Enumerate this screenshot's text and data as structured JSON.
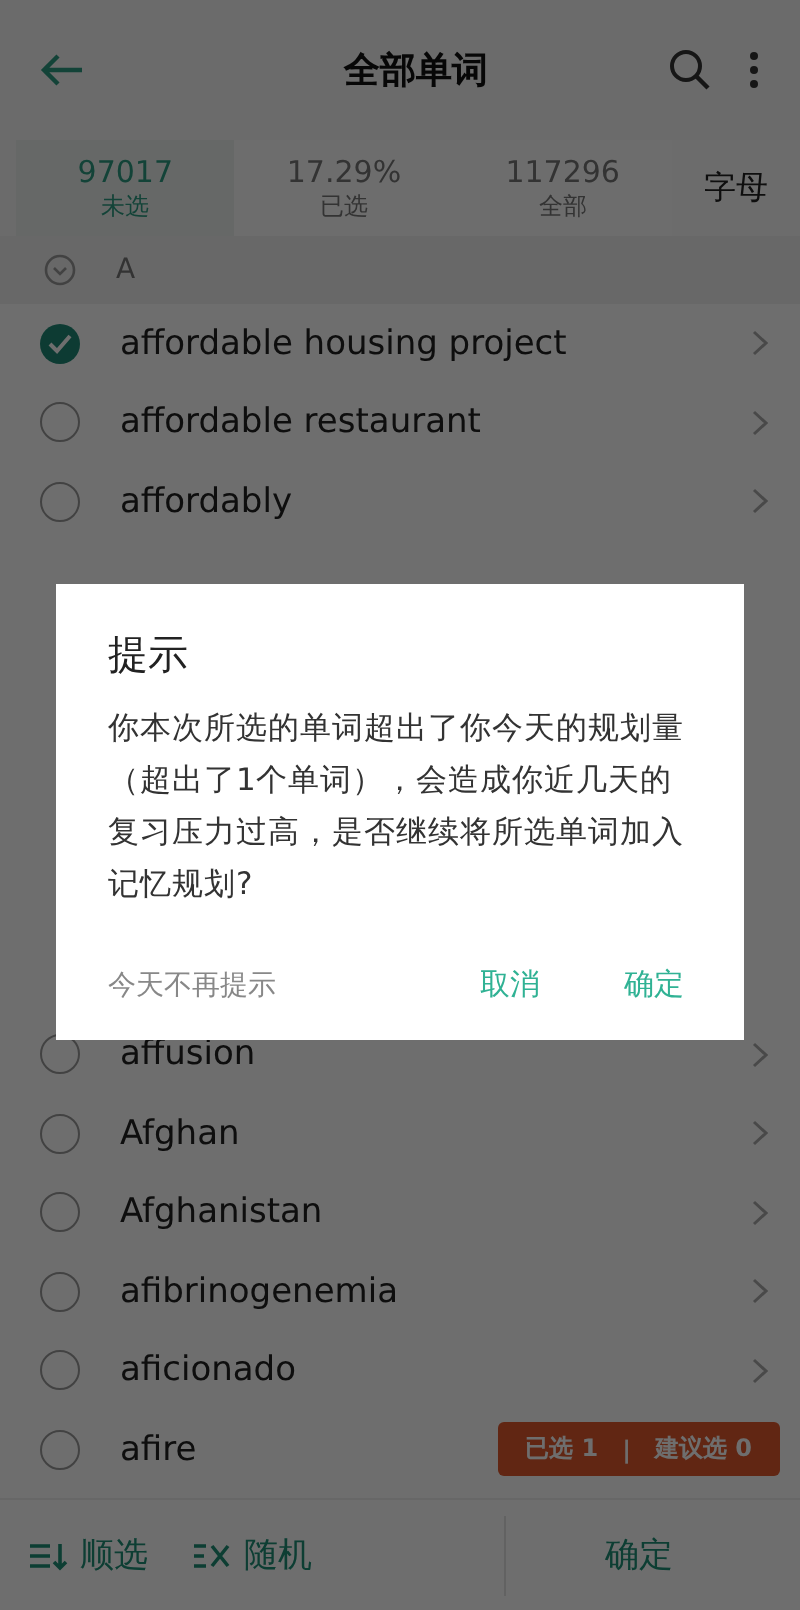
{
  "header": {
    "title": "全部单词"
  },
  "stats": [
    {
      "value": "97017",
      "label": "未选",
      "selected": true
    },
    {
      "value": "17.29%",
      "label": "已选",
      "selected": false
    },
    {
      "value": "117296",
      "label": "全部",
      "selected": false
    }
  ],
  "letter_button": "字母",
  "section": {
    "letter": "A"
  },
  "words": [
    {
      "word": "affordable housing project",
      "checked": true
    },
    {
      "word": "affordable restaurant",
      "checked": false
    },
    {
      "word": "affordably",
      "checked": false
    },
    {
      "word": "affusion",
      "checked": false
    },
    {
      "word": "Afghan",
      "checked": false
    },
    {
      "word": "Afghanistan",
      "checked": false
    },
    {
      "word": "afibrinogenemia",
      "checked": false
    },
    {
      "word": "aficionado",
      "checked": false
    },
    {
      "word": "afire",
      "checked": false
    }
  ],
  "selection_badge": {
    "selected": "已选 1",
    "separator": "|",
    "suggested": "建议选 0"
  },
  "bottom_bar": {
    "order_button": "顺选",
    "random_button": "随机",
    "confirm_button": "确定"
  },
  "dialog": {
    "title": "提示",
    "message": "你本次所选的单词超出了你今天的规划量（超出了1个单词），会造成你近几天的复习压力过高，是否继续将所选单词加入记忆规划?",
    "dont_remind": "今天不再提示",
    "cancel": "取消",
    "confirm": "确定"
  }
}
